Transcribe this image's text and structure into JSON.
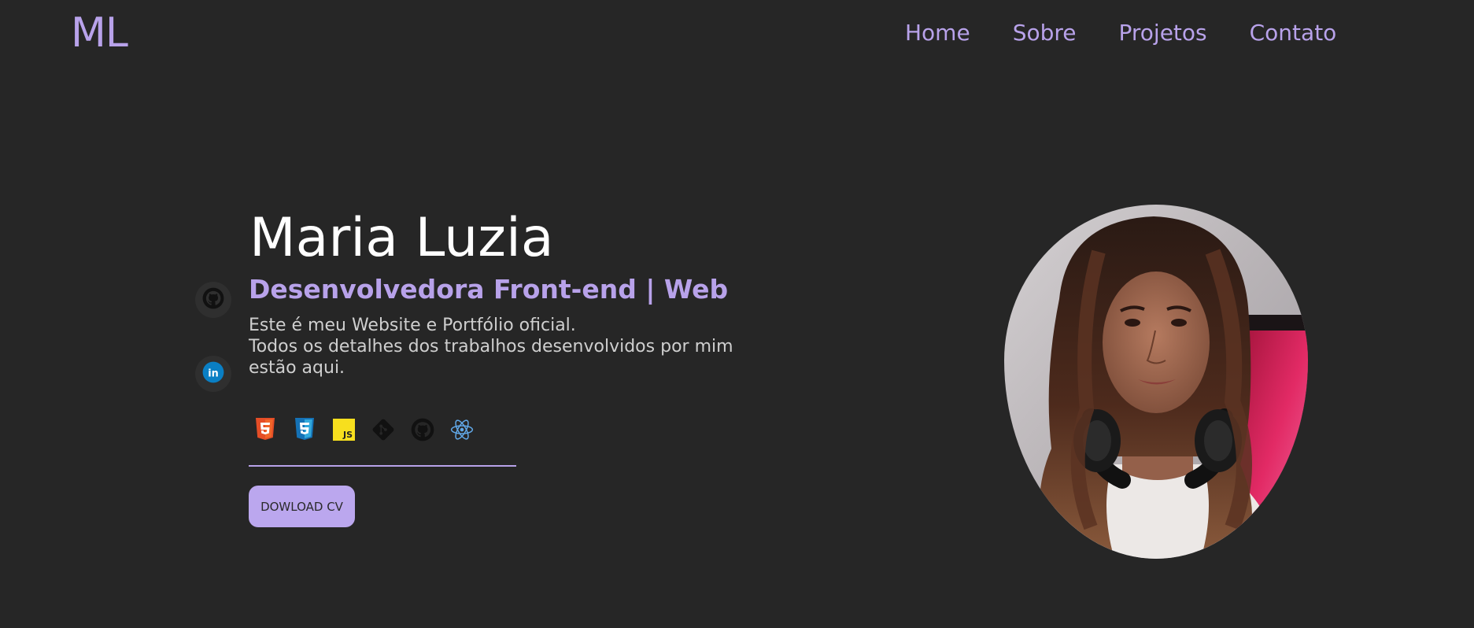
{
  "header": {
    "logo": "ML",
    "nav": [
      "Home",
      "Sobre",
      "Projetos",
      "Contato"
    ]
  },
  "social": [
    {
      "icon": "github-icon"
    },
    {
      "icon": "linkedin-icon"
    }
  ],
  "hero": {
    "name": "Maria Luzia",
    "role": "Desenvolvedora Front-end | Web",
    "description_line1": "Este é meu Website e Portfólio oficial.",
    "description_line2": "Todos os detalhes dos trabalhos desenvolvidos por mim estão aqui.",
    "tech_icons": [
      "html5-icon",
      "css3-icon",
      "javascript-icon",
      "git-icon",
      "github-icon",
      "react-icon"
    ],
    "cv_button": "DOWLOAD CV"
  },
  "colors": {
    "background": "#262626",
    "accent": "#b8a2ea",
    "button": "#bba7ee",
    "text": "#ffffff",
    "muted_text": "#cfcfcf"
  }
}
